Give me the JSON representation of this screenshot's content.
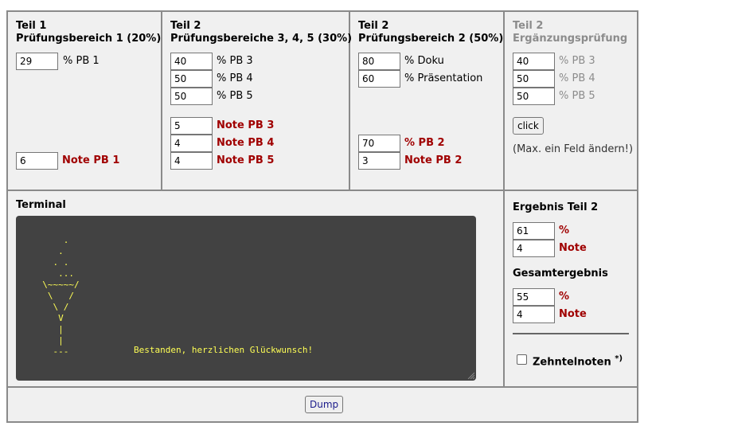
{
  "col1": {
    "title1": "Teil 1",
    "title2": "Prüfungsbereich 1 (20%)",
    "pct_value": "29",
    "pct_label": "% PB 1",
    "note_value": "6",
    "note_label": "Note PB 1"
  },
  "col2": {
    "title1": "Teil 2",
    "title2": "Prüfungsbereiche 3, 4, 5 (30%)",
    "pct": [
      {
        "value": "40",
        "label": "% PB 3"
      },
      {
        "value": "50",
        "label": "% PB 4"
      },
      {
        "value": "50",
        "label": "% PB 5"
      }
    ],
    "notes": [
      {
        "value": "5",
        "label": "Note PB 3"
      },
      {
        "value": "4",
        "label": "Note PB 4"
      },
      {
        "value": "4",
        "label": "Note PB 5"
      }
    ]
  },
  "col3": {
    "title1": "Teil 2",
    "title2": "Prüfungsbereich 2 (50%)",
    "doku_value": "80",
    "doku_label": "% Doku",
    "praes_value": "60",
    "praes_label": "% Präsentation",
    "pb2_value": "70",
    "pb2_label": "% PB 2",
    "note_value": "3",
    "note_label": "Note PB 2"
  },
  "col4": {
    "title1": "Teil 2",
    "title2": "Ergänzungsprüfung",
    "fields": [
      {
        "value": "40",
        "label": "% PB 3"
      },
      {
        "value": "50",
        "label": "% PB 4"
      },
      {
        "value": "50",
        "label": "% PB 5"
      }
    ],
    "button": "click",
    "hint": "(Max. ein Feld ändern!)"
  },
  "terminal": {
    "title": "Terminal",
    "art": "      .\n     .\n    . .\n     ...\n  \\~~~~~/\n   \\   /\n    \\ /\n     V\n     |\n     |\n    ---",
    "message": "Bestanden, herzlichen Glückwunsch!"
  },
  "results": {
    "teil2_title": "Ergebnis Teil 2",
    "teil2_pct": "61",
    "teil2_note": "4",
    "gesamt_title": "Gesamtergebnis",
    "gesamt_pct": "55",
    "gesamt_note": "4",
    "pct_label": "%",
    "note_label": "Note",
    "zehntel_label": "Zehntelnoten",
    "zehntel_sup": "*)"
  },
  "footer": {
    "dump": "Dump"
  }
}
